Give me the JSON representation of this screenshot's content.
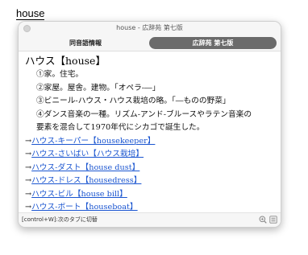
{
  "lookup_word": "house",
  "window": {
    "title": "house - 広辞苑 第七版"
  },
  "tabs": [
    {
      "label": "同音語情報",
      "active": false
    },
    {
      "label": "広辞苑 第七版",
      "active": true
    }
  ],
  "entry": {
    "headword": "ハウス【house】",
    "senses": [
      "①家。住宅。",
      "②家屋。屋舎。建物。「オペラ‐―」",
      "③ビニール‐ハウス・ハウス栽培の略。「―ものの野菜」",
      "④ダンス音楽の一種。リズム‐アンド‐ブルースやラテン音楽の",
      "要素を混合して1970年代にシカゴで誕生した。"
    ],
    "xrefs": [
      {
        "arrow": "→",
        "text": "ハウス‐キーパー【housekeeper】"
      },
      {
        "arrow": "→",
        "text": "ハウス‐さいばい【ハウス栽培】"
      },
      {
        "arrow": "→",
        "text": "ハウス‐ダスト【house dust】"
      },
      {
        "arrow": "→",
        "text": "ハウス‐ドレス【housedress】"
      },
      {
        "arrow": "→",
        "text": "ハウス‐ビル【house bill】"
      },
      {
        "arrow": "→",
        "text": "ハウス‐ボート【houseboat】"
      }
    ]
  },
  "status": {
    "shortcut": "[control+W]:次のタブに切替"
  },
  "icons": {
    "zoom": "zoom-icon",
    "list": "list-icon"
  }
}
